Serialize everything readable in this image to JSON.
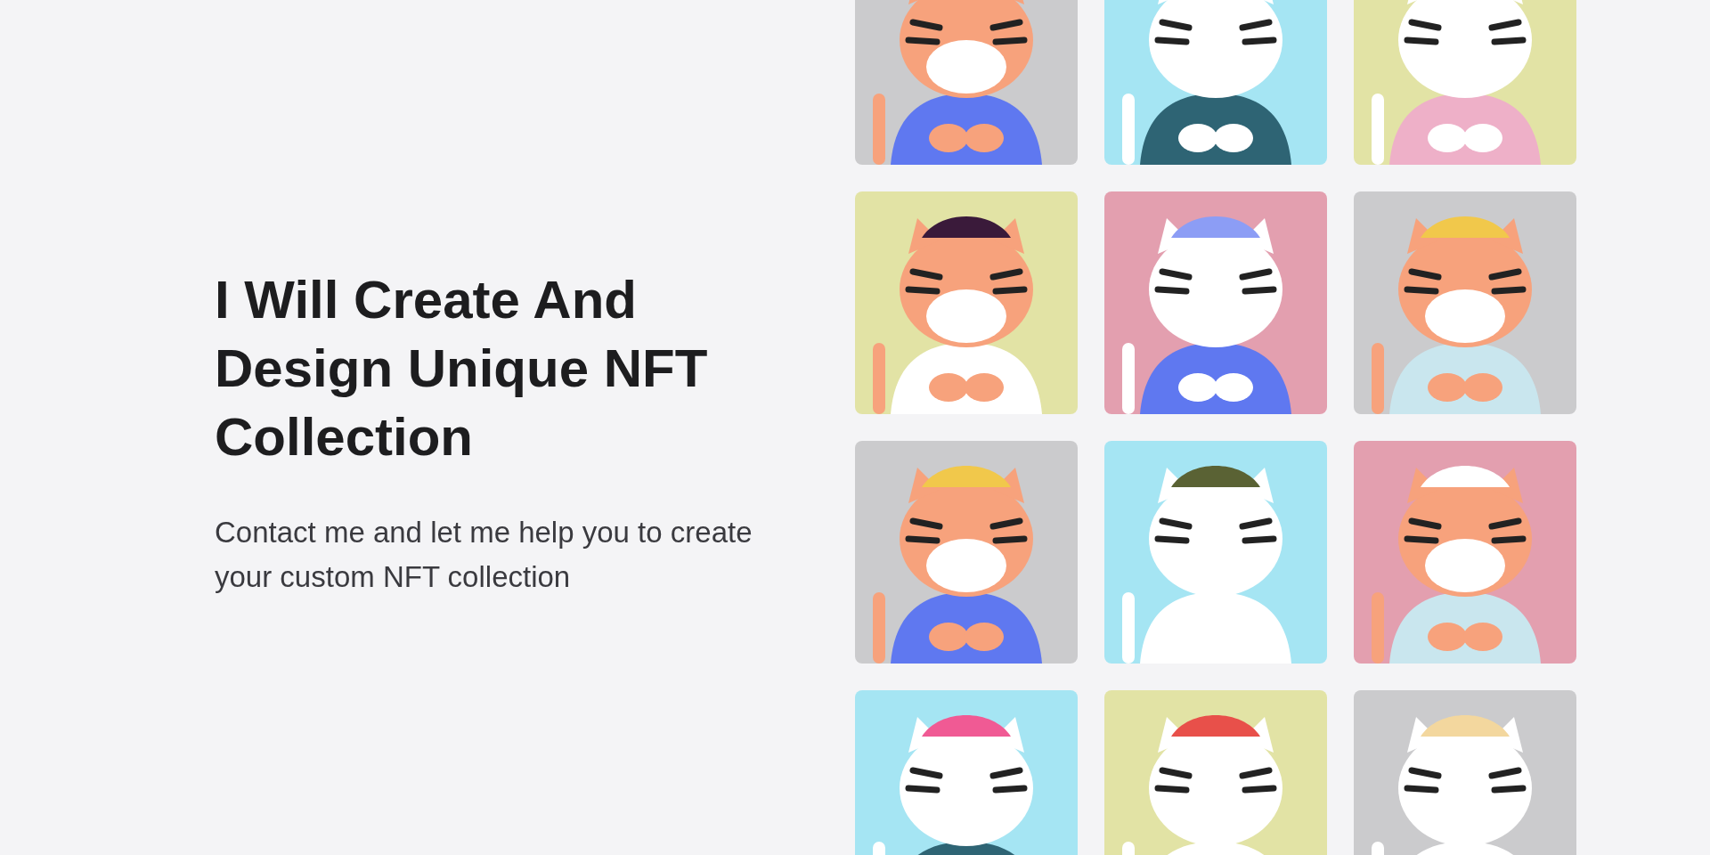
{
  "hero": {
    "title": "I Will Create And Design Unique NFT Collection",
    "subtitle": "Contact me and let me help you to create your custom NFT collection"
  }
}
